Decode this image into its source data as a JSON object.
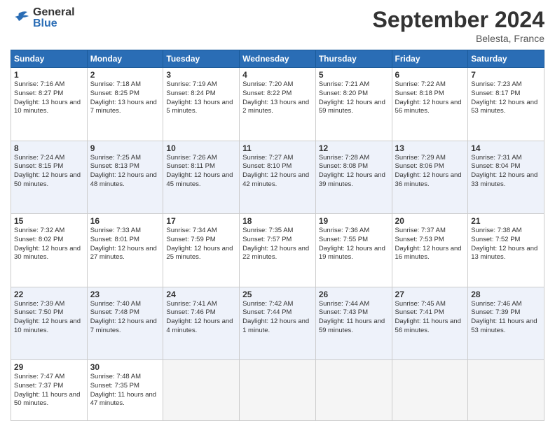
{
  "logo": {
    "general": "General",
    "blue": "Blue"
  },
  "header": {
    "title": "September 2024",
    "location": "Belesta, France"
  },
  "days_of_week": [
    "Sunday",
    "Monday",
    "Tuesday",
    "Wednesday",
    "Thursday",
    "Friday",
    "Saturday"
  ],
  "weeks": [
    {
      "row_shade": "normal",
      "days": [
        {
          "num": "1",
          "sunrise": "Sunrise: 7:16 AM",
          "sunset": "Sunset: 8:27 PM",
          "daylight": "Daylight: 13 hours and 10 minutes."
        },
        {
          "num": "2",
          "sunrise": "Sunrise: 7:18 AM",
          "sunset": "Sunset: 8:25 PM",
          "daylight": "Daylight: 13 hours and 7 minutes."
        },
        {
          "num": "3",
          "sunrise": "Sunrise: 7:19 AM",
          "sunset": "Sunset: 8:24 PM",
          "daylight": "Daylight: 13 hours and 5 minutes."
        },
        {
          "num": "4",
          "sunrise": "Sunrise: 7:20 AM",
          "sunset": "Sunset: 8:22 PM",
          "daylight": "Daylight: 13 hours and 2 minutes."
        },
        {
          "num": "5",
          "sunrise": "Sunrise: 7:21 AM",
          "sunset": "Sunset: 8:20 PM",
          "daylight": "Daylight: 12 hours and 59 minutes."
        },
        {
          "num": "6",
          "sunrise": "Sunrise: 7:22 AM",
          "sunset": "Sunset: 8:18 PM",
          "daylight": "Daylight: 12 hours and 56 minutes."
        },
        {
          "num": "7",
          "sunrise": "Sunrise: 7:23 AM",
          "sunset": "Sunset: 8:17 PM",
          "daylight": "Daylight: 12 hours and 53 minutes."
        }
      ]
    },
    {
      "row_shade": "alt",
      "days": [
        {
          "num": "8",
          "sunrise": "Sunrise: 7:24 AM",
          "sunset": "Sunset: 8:15 PM",
          "daylight": "Daylight: 12 hours and 50 minutes."
        },
        {
          "num": "9",
          "sunrise": "Sunrise: 7:25 AM",
          "sunset": "Sunset: 8:13 PM",
          "daylight": "Daylight: 12 hours and 48 minutes."
        },
        {
          "num": "10",
          "sunrise": "Sunrise: 7:26 AM",
          "sunset": "Sunset: 8:11 PM",
          "daylight": "Daylight: 12 hours and 45 minutes."
        },
        {
          "num": "11",
          "sunrise": "Sunrise: 7:27 AM",
          "sunset": "Sunset: 8:10 PM",
          "daylight": "Daylight: 12 hours and 42 minutes."
        },
        {
          "num": "12",
          "sunrise": "Sunrise: 7:28 AM",
          "sunset": "Sunset: 8:08 PM",
          "daylight": "Daylight: 12 hours and 39 minutes."
        },
        {
          "num": "13",
          "sunrise": "Sunrise: 7:29 AM",
          "sunset": "Sunset: 8:06 PM",
          "daylight": "Daylight: 12 hours and 36 minutes."
        },
        {
          "num": "14",
          "sunrise": "Sunrise: 7:31 AM",
          "sunset": "Sunset: 8:04 PM",
          "daylight": "Daylight: 12 hours and 33 minutes."
        }
      ]
    },
    {
      "row_shade": "normal",
      "days": [
        {
          "num": "15",
          "sunrise": "Sunrise: 7:32 AM",
          "sunset": "Sunset: 8:02 PM",
          "daylight": "Daylight: 12 hours and 30 minutes."
        },
        {
          "num": "16",
          "sunrise": "Sunrise: 7:33 AM",
          "sunset": "Sunset: 8:01 PM",
          "daylight": "Daylight: 12 hours and 27 minutes."
        },
        {
          "num": "17",
          "sunrise": "Sunrise: 7:34 AM",
          "sunset": "Sunset: 7:59 PM",
          "daylight": "Daylight: 12 hours and 25 minutes."
        },
        {
          "num": "18",
          "sunrise": "Sunrise: 7:35 AM",
          "sunset": "Sunset: 7:57 PM",
          "daylight": "Daylight: 12 hours and 22 minutes."
        },
        {
          "num": "19",
          "sunrise": "Sunrise: 7:36 AM",
          "sunset": "Sunset: 7:55 PM",
          "daylight": "Daylight: 12 hours and 19 minutes."
        },
        {
          "num": "20",
          "sunrise": "Sunrise: 7:37 AM",
          "sunset": "Sunset: 7:53 PM",
          "daylight": "Daylight: 12 hours and 16 minutes."
        },
        {
          "num": "21",
          "sunrise": "Sunrise: 7:38 AM",
          "sunset": "Sunset: 7:52 PM",
          "daylight": "Daylight: 12 hours and 13 minutes."
        }
      ]
    },
    {
      "row_shade": "alt",
      "days": [
        {
          "num": "22",
          "sunrise": "Sunrise: 7:39 AM",
          "sunset": "Sunset: 7:50 PM",
          "daylight": "Daylight: 12 hours and 10 minutes."
        },
        {
          "num": "23",
          "sunrise": "Sunrise: 7:40 AM",
          "sunset": "Sunset: 7:48 PM",
          "daylight": "Daylight: 12 hours and 7 minutes."
        },
        {
          "num": "24",
          "sunrise": "Sunrise: 7:41 AM",
          "sunset": "Sunset: 7:46 PM",
          "daylight": "Daylight: 12 hours and 4 minutes."
        },
        {
          "num": "25",
          "sunrise": "Sunrise: 7:42 AM",
          "sunset": "Sunset: 7:44 PM",
          "daylight": "Daylight: 12 hours and 1 minute."
        },
        {
          "num": "26",
          "sunrise": "Sunrise: 7:44 AM",
          "sunset": "Sunset: 7:43 PM",
          "daylight": "Daylight: 11 hours and 59 minutes."
        },
        {
          "num": "27",
          "sunrise": "Sunrise: 7:45 AM",
          "sunset": "Sunset: 7:41 PM",
          "daylight": "Daylight: 11 hours and 56 minutes."
        },
        {
          "num": "28",
          "sunrise": "Sunrise: 7:46 AM",
          "sunset": "Sunset: 7:39 PM",
          "daylight": "Daylight: 11 hours and 53 minutes."
        }
      ]
    },
    {
      "row_shade": "normal",
      "days": [
        {
          "num": "29",
          "sunrise": "Sunrise: 7:47 AM",
          "sunset": "Sunset: 7:37 PM",
          "daylight": "Daylight: 11 hours and 50 minutes."
        },
        {
          "num": "30",
          "sunrise": "Sunrise: 7:48 AM",
          "sunset": "Sunset: 7:35 PM",
          "daylight": "Daylight: 11 hours and 47 minutes."
        },
        {
          "num": "",
          "sunrise": "",
          "sunset": "",
          "daylight": ""
        },
        {
          "num": "",
          "sunrise": "",
          "sunset": "",
          "daylight": ""
        },
        {
          "num": "",
          "sunrise": "",
          "sunset": "",
          "daylight": ""
        },
        {
          "num": "",
          "sunrise": "",
          "sunset": "",
          "daylight": ""
        },
        {
          "num": "",
          "sunrise": "",
          "sunset": "",
          "daylight": ""
        }
      ]
    }
  ]
}
